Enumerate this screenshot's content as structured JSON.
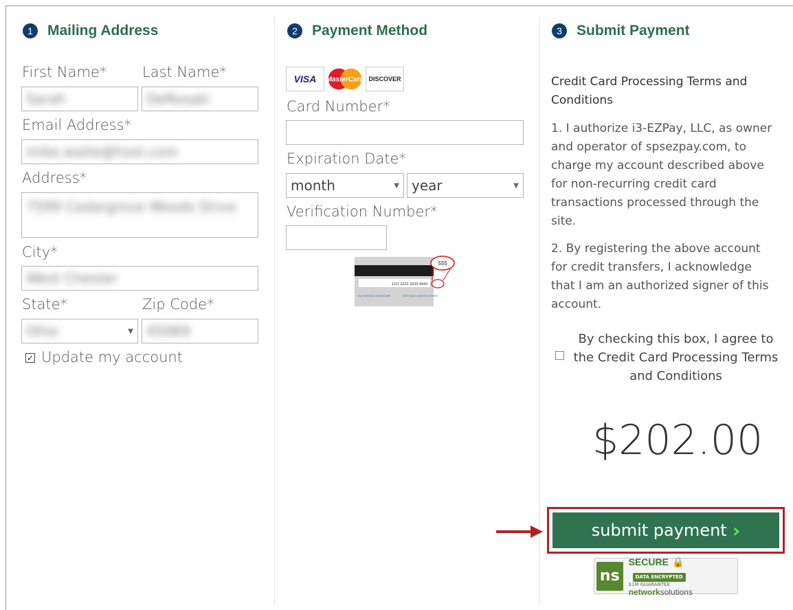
{
  "steps": [
    {
      "num": "1",
      "title": "Mailing Address"
    },
    {
      "num": "2",
      "title": "Payment Method"
    },
    {
      "num": "3",
      "title": "Submit Payment"
    }
  ],
  "mailing": {
    "first_name_label": "First Name*",
    "last_name_label": "Last Name*",
    "first_name_value": "Sarah",
    "last_name_value": "DeRosaki",
    "email_label": "Email Address*",
    "email_value": "mike.waite@host.com",
    "address_label": "Address*",
    "address_value": "7599 Cedargrove Woods Drive",
    "city_label": "City*",
    "city_value": "West Chester",
    "state_label": "State*",
    "state_value": "Ohio",
    "zip_label": "Zip Code*",
    "zip_value": "45069",
    "update_account_label": "Update my account",
    "update_account_checked": true
  },
  "payment": {
    "card_brands": [
      "VISA",
      "MasterCard",
      "DISCOVER"
    ],
    "card_number_label": "Card Number*",
    "card_number_value": "",
    "expiration_label": "Expiration Date*",
    "month_value": "month",
    "year_value": "year",
    "verification_label": "Verification Number*",
    "verification_value": "",
    "cvv_sample": "555",
    "card_sample_number": "1111 2222 3333 4444",
    "card_sig_left": "AUTHORIZED SIGNATURE",
    "card_sig_right": "NOT VALID UNLESS SIGNED"
  },
  "submit": {
    "terms_title": "Credit Card Processing Terms and Conditions",
    "term1": "1. I authorize i3-EZPay, LLC, as owner and operator of spsezpay.com, to charge my account described above for non-recurring credit card transactions processed through the site.",
    "term2": "2. By registering the above account for credit transfers, I acknowledge that I am an authorized signer of this account.",
    "agree_label": "By checking this box, I agree to the Credit Card Processing Terms and Conditions",
    "agree_checked": false,
    "amount": "$202.00",
    "button_label": "submit payment",
    "badge_secure": "SECURE",
    "badge_guarantee": "$1M GUARANTEE",
    "badge_encrypted": "DATA ENCRYPTED",
    "badge_brand_bold": "network",
    "badge_brand_rest": "solutions"
  },
  "colors": {
    "heading_green": "#2e6e4e",
    "step_circle": "#0f3c6e",
    "button_bg": "#2f7350",
    "highlight_red": "#b51f24"
  }
}
